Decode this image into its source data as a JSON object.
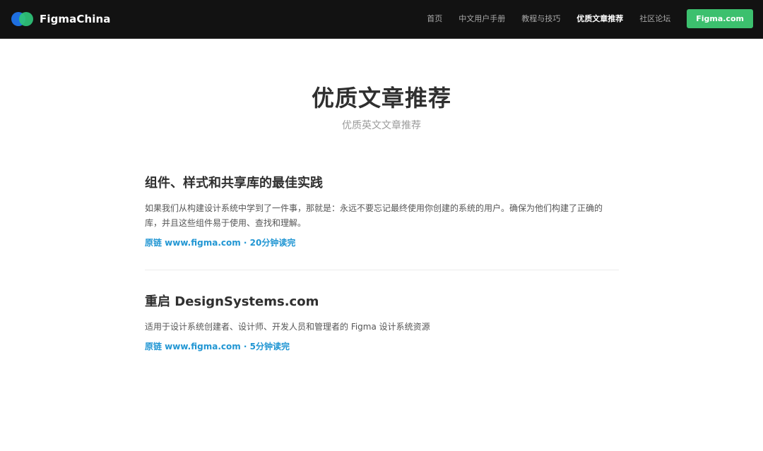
{
  "header": {
    "brand": "FigmaChina",
    "nav": [
      {
        "label": "首页"
      },
      {
        "label": "中文用户手册"
      },
      {
        "label": "教程与技巧"
      },
      {
        "label": "优质文章推荐",
        "active": true
      },
      {
        "label": "社区论坛"
      }
    ],
    "cta_label": "Figma.com"
  },
  "hero": {
    "title": "优质文章推荐",
    "subtitle": "优质英文文章推荐"
  },
  "articles": [
    {
      "title": "组件、样式和共享库的最佳实践",
      "description": "如果我们从构建设计系统中学到了一件事，那就是：永远不要忘记最终使用你创建的系统的用户。确保为他们构建了正确的库，并且这些组件易于使用、查找和理解。",
      "meta": "原链 www.figma.com · 20分钟读完"
    },
    {
      "title": "重启 DesignSystems.com",
      "description": "适用于设计系统创建者、设计师、开发人员和管理者的 Figma 设计系统资源",
      "meta": "原链 www.figma.com · 5分钟读完"
    }
  ],
  "colors": {
    "header_bg": "#121212",
    "accent_green": "#3cc06e",
    "link_blue": "#2196d3",
    "logo_blue": "#1e6fe0",
    "logo_green": "#2fc47a"
  }
}
